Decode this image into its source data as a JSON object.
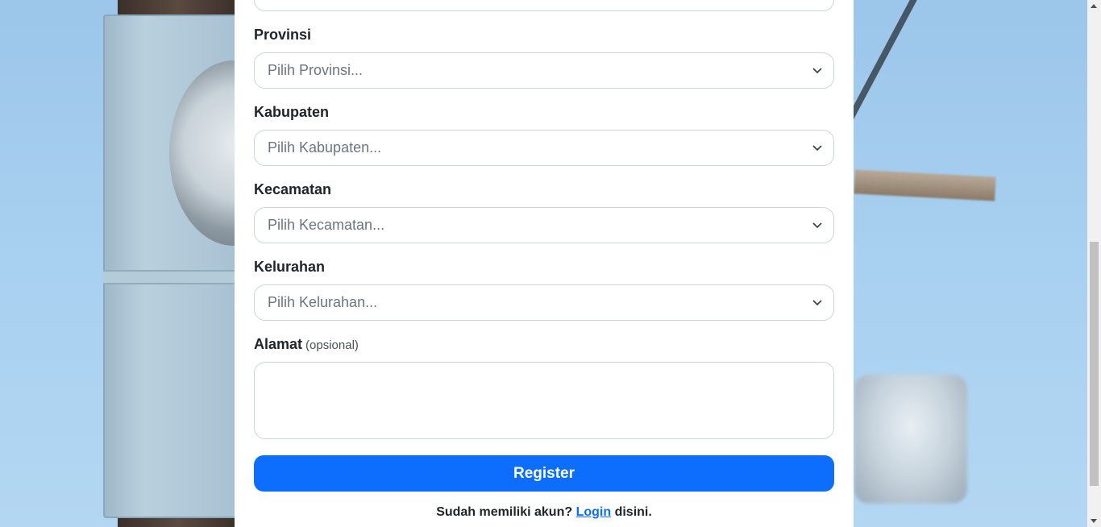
{
  "form": {
    "provinsi": {
      "label": "Provinsi",
      "placeholder": "Pilih Provinsi..."
    },
    "kabupaten": {
      "label": "Kabupaten",
      "placeholder": "Pilih Kabupaten..."
    },
    "kecamatan": {
      "label": "Kecamatan",
      "placeholder": "Pilih Kecamatan..."
    },
    "kelurahan": {
      "label": "Kelurahan",
      "placeholder": "Pilih Kelurahan..."
    },
    "alamat": {
      "label": "Alamat",
      "optional_note": "(opsional)",
      "value": ""
    },
    "register_label": "Register"
  },
  "footer": {
    "prefix": "Sudah memiliki akun?",
    "link_label": "Login",
    "suffix": "disini."
  },
  "icons": {
    "select_chevron": "chevron-down-icon"
  },
  "colors": {
    "primary": "#0d6efd",
    "border": "#ced4da",
    "placeholder": "#6c757d",
    "text": "#212529"
  }
}
